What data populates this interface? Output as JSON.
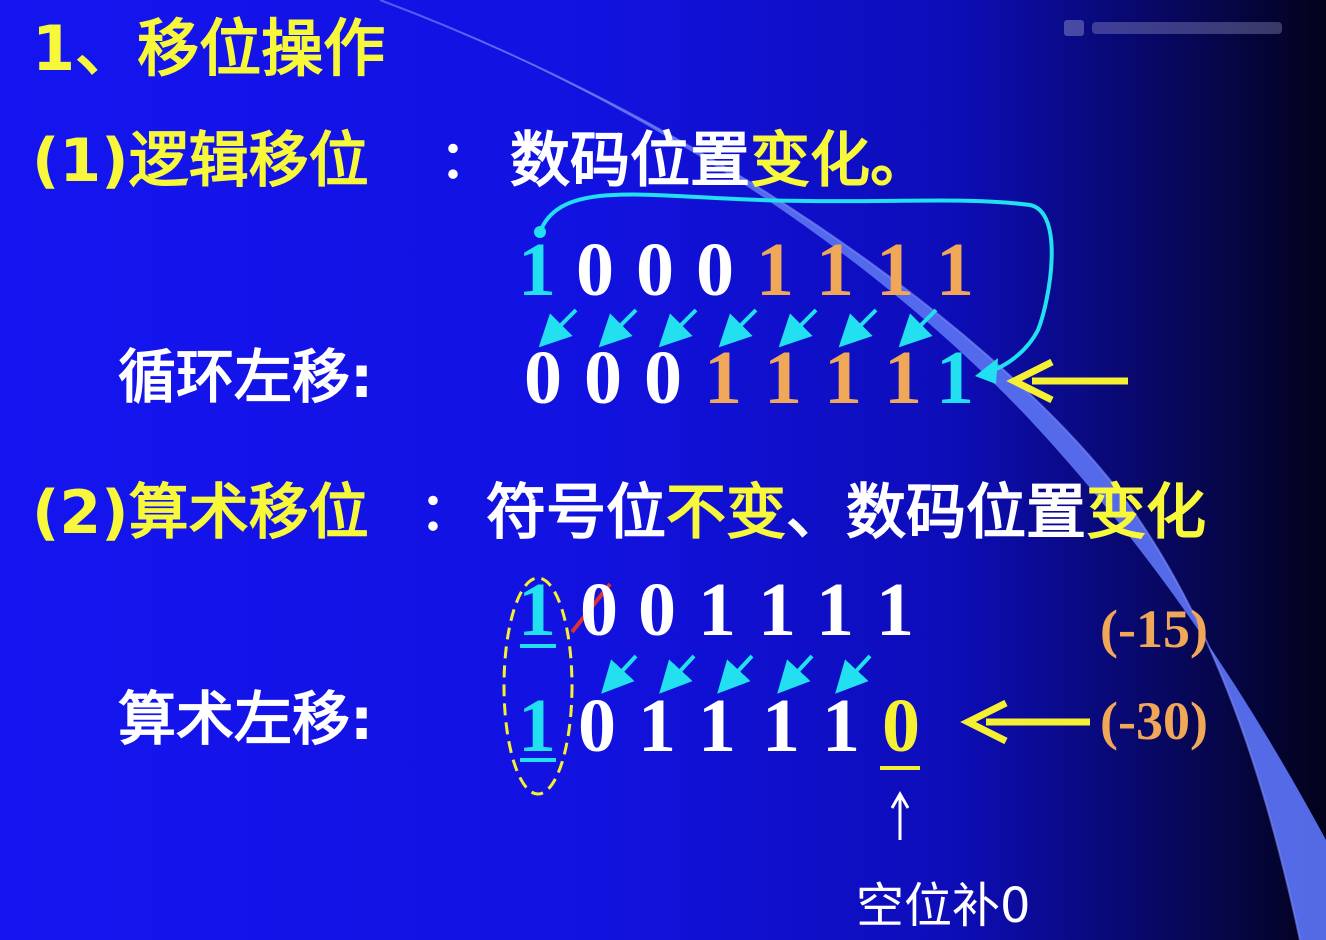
{
  "title": "1、移位操作",
  "logical": {
    "heading": "(1)逻辑移位",
    "colon": "：",
    "desc_part1": "数码位置",
    "desc_part2": "变化。",
    "label": "循环左移:",
    "original_bits": [
      "1",
      "0",
      "0",
      "0",
      "1",
      "1",
      "1",
      "1"
    ],
    "shifted_bits": [
      "0",
      "0",
      "0",
      "1",
      "1",
      "1",
      "1",
      "1"
    ]
  },
  "arithmetic": {
    "heading": "(2)算术移位",
    "colon": "：",
    "desc_part1": "符号位",
    "desc_part2": "不变",
    "desc_part3": "、数码位置",
    "desc_part4": "变化",
    "label": "算术左移:",
    "original_bits": [
      "1",
      "0",
      "0",
      "1",
      "1",
      "1",
      "1"
    ],
    "shifted_bits": [
      "1",
      "0",
      "1",
      "1",
      "1",
      "1",
      "0"
    ],
    "original_value": "(-15)",
    "shifted_value": "(-30)",
    "note": "空位补0"
  },
  "colors": {
    "background": "#1414f0",
    "heading_yellow": "#f8f83a",
    "highlight_orange": "#f0a858",
    "highlight_cyan": "#22e0f0",
    "arrow_yellow": "#f6f032",
    "strike_red": "#e03030"
  }
}
